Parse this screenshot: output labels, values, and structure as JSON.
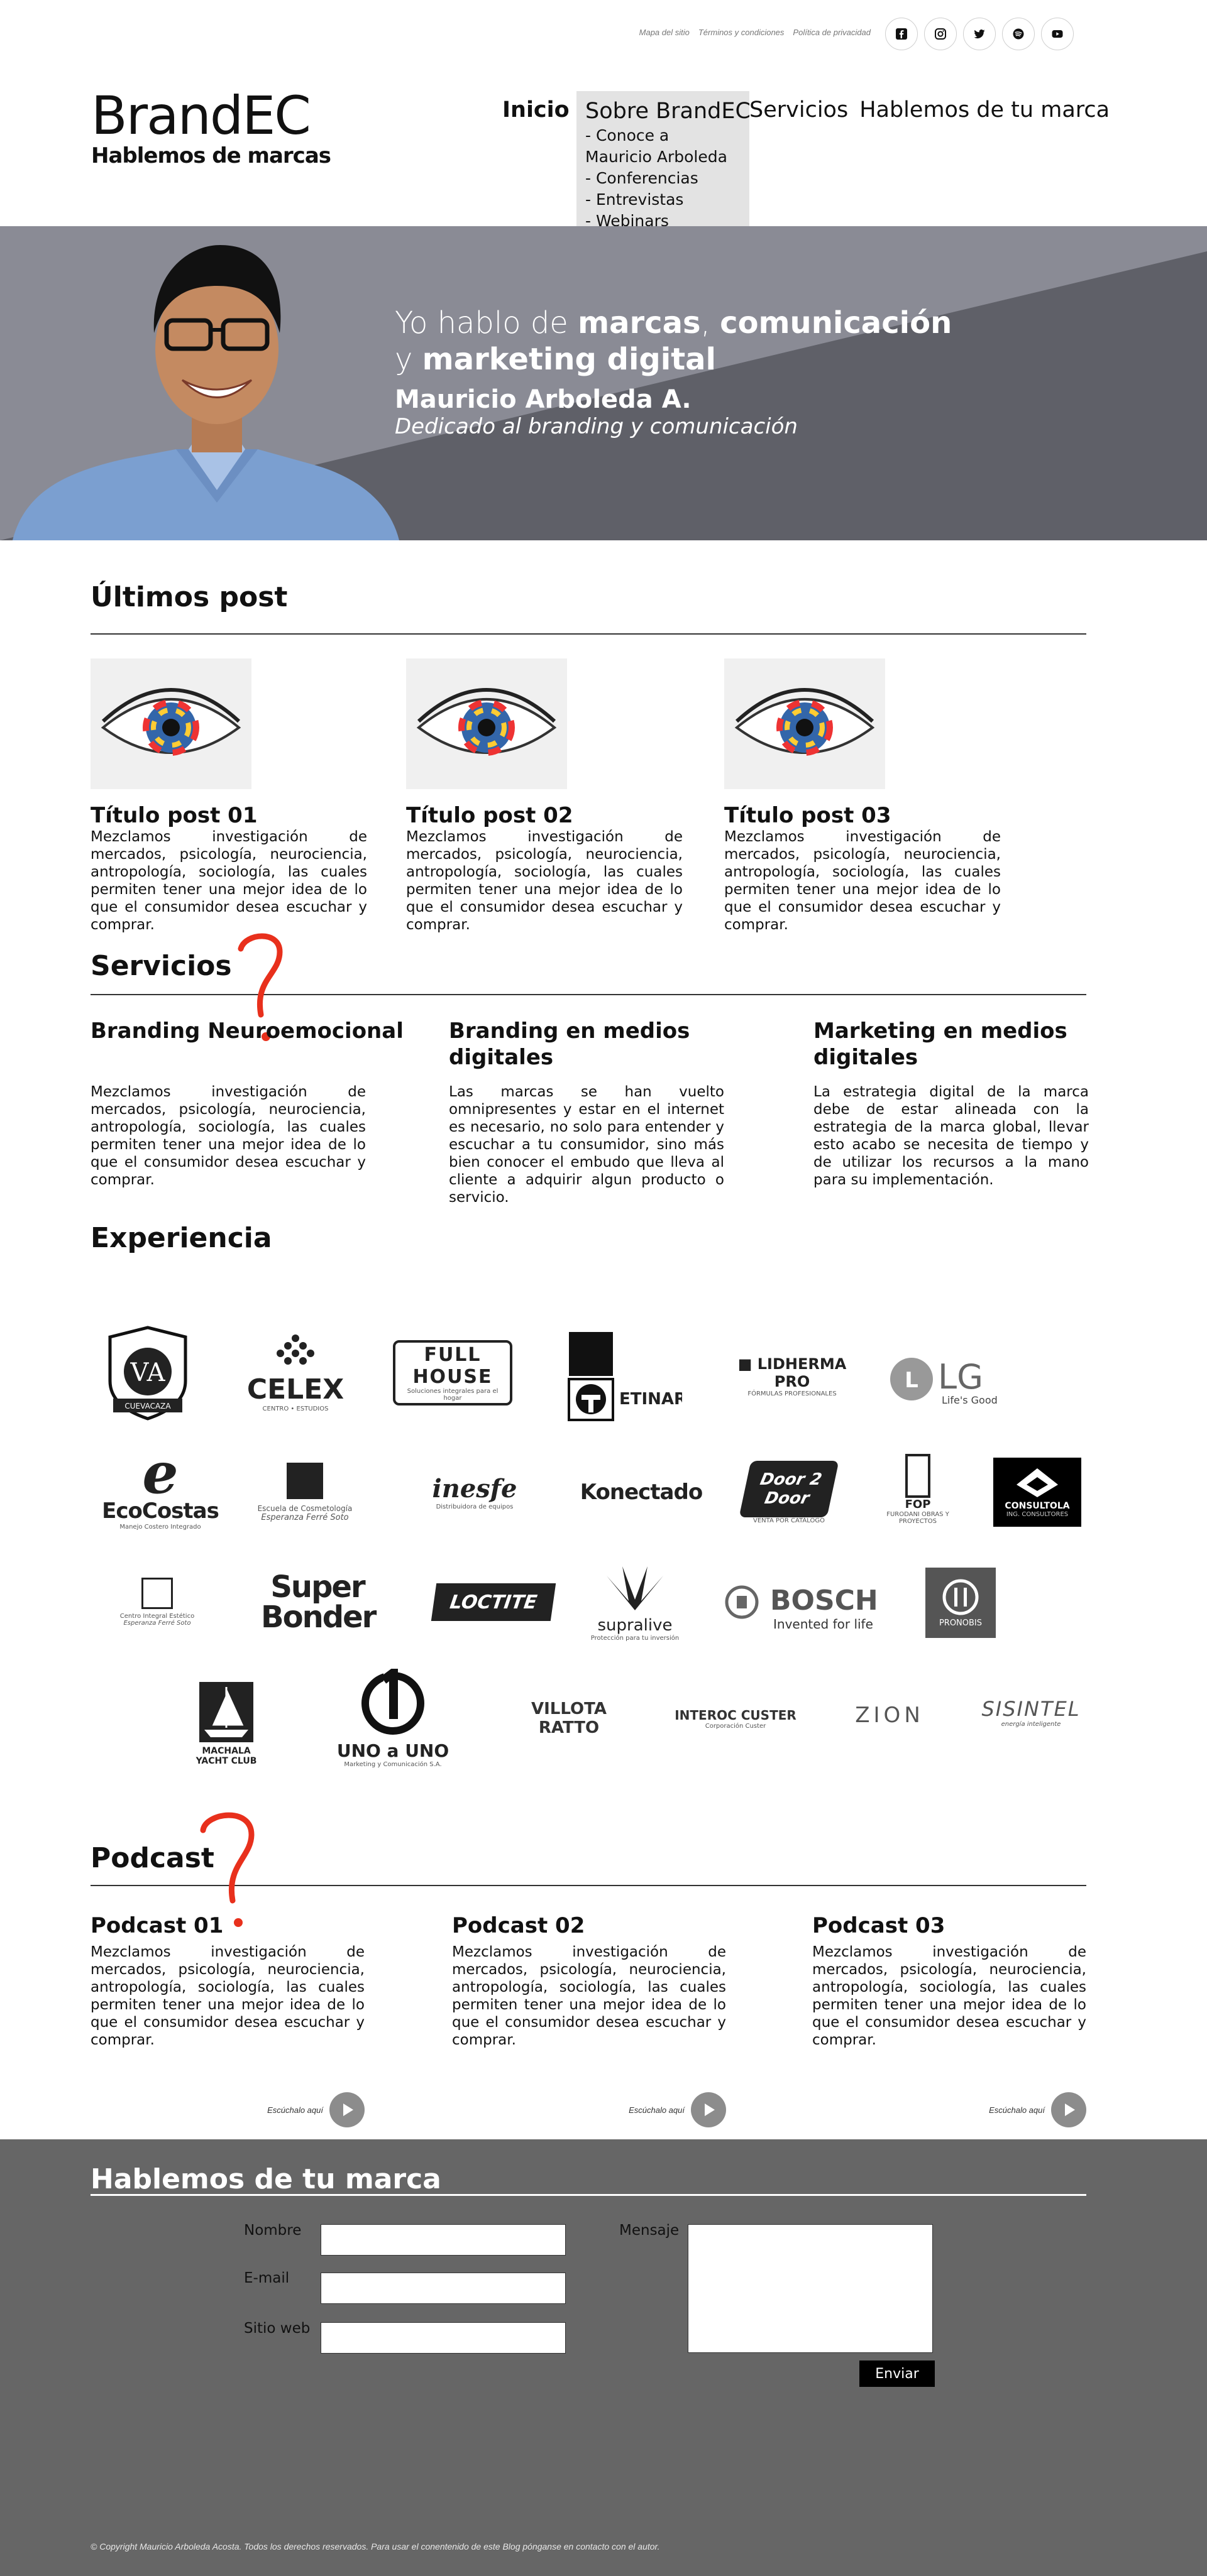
{
  "util_links": [
    "Mapa del sitio",
    "Términos y condiciones",
    "Política de privacidad"
  ],
  "social_icons": [
    "facebook-icon",
    "instagram-icon",
    "twitter-icon",
    "spotify-icon",
    "youtube-icon"
  ],
  "logo": {
    "main": "BrandEC",
    "sub": "Hablemos de marcas"
  },
  "nav": {
    "home": "Inicio",
    "about": "Sobre BrandEC",
    "about_items": [
      "- Conoce a Mauricio Arboleda",
      "- Conferencias",
      "- Entrevistas",
      "- Webinars"
    ],
    "services": "Servicios",
    "talk": "Hablemos de tu marca"
  },
  "hero": {
    "line1_a": "Yo hablo de ",
    "line1_b": "marcas",
    "line1_c": ", ",
    "line1_d": "comunicación",
    "line2_a": "y ",
    "line2_b": "marketing digital",
    "name": "Mauricio Arboleda A.",
    "role": "Dedicado al branding y comunicación"
  },
  "posts": {
    "title": "Últimos post",
    "items": [
      {
        "title": "Título post 01",
        "text": "Mezclamos investigación de mercados, psicología, neurociencia, antropología, sociología, las cuales permiten tener una mejor idea de lo que el consumidor desea escuchar y comprar."
      },
      {
        "title": "Título post 02",
        "text": "Mezclamos investigación de mercados, psicología, neurociencia, antropología, sociología, las cuales permiten tener una mejor idea de lo que el consumidor desea escuchar y comprar."
      },
      {
        "title": "Título post 03",
        "text": "Mezclamos investigación de mercados, psicología, neurociencia, antropología, sociología, las cuales permiten tener una mejor idea de lo que el consumidor desea escuchar y comprar."
      }
    ]
  },
  "services": {
    "title": "Servicios",
    "items": [
      {
        "title": "Branding Neuroemocional",
        "text": "Mezclamos investigación de mercados, psicología, neurociencia, antropología, sociología, las cuales permiten tener una mejor idea de lo que el consumidor desea escuchar y comprar."
      },
      {
        "title": "Branding en medios digitales",
        "text": "Las marcas se han vuelto omnipresentes y estar en el internet es necesario, no solo para entender y escuchar a tu consumidor, sino más bien conocer el embudo que lleva al cliente a adquirir algun producto o servicio."
      },
      {
        "title": "Marketing en medios digitales",
        "text": "La estrategia digital de la marca debe de estar alineada con la estrategia de la marca global, llevar esto acabo se necesita de tiempo y de utilizar los recursos a la mano para su implementación."
      }
    ]
  },
  "experience": {
    "title": "Experiencia",
    "logos": [
      {
        "name": "VA",
        "sub": "CUEVACAZA"
      },
      {
        "name": "CELEX",
        "sub": "CENTRO • ESTUDIOS"
      },
      {
        "name": "FULL HOUSE",
        "sub": "Soluciones integrales para el hogar"
      },
      {
        "name": "ETINAR",
        "sub": ""
      },
      {
        "name": "LIDHERMA PRO",
        "sub": "FÓRMULAS PROFESIONALES"
      },
      {
        "name": "LG",
        "sub": "Life's Good"
      },
      {
        "name": "EcoCostas",
        "sub": "Manejo Costero Integrado"
      },
      {
        "name": "Escuela de Cosmetología",
        "sub": "Esperanza Ferré Soto"
      },
      {
        "name": "inesfe",
        "sub": "Distribuidora de equipos"
      },
      {
        "name": "Konectado",
        "sub": ""
      },
      {
        "name": "Door 2 Door",
        "sub": "VENTA POR CATÁLOGO"
      },
      {
        "name": "FOP",
        "sub": "FURODANI OBRAS Y PROYECTOS"
      },
      {
        "name": "CONSULTOLA",
        "sub": "ING. CONSULTORES"
      },
      {
        "name": "Centro Integral Estético",
        "sub": "Esperanza Ferré Soto"
      },
      {
        "name": "Super Bonder",
        "sub": ""
      },
      {
        "name": "LOCTITE",
        "sub": ""
      },
      {
        "name": "supralive",
        "sub": "Protección para tu inversión"
      },
      {
        "name": "BOSCH",
        "sub": "Invented for life"
      },
      {
        "name": "PRONOBIS",
        "sub": ""
      },
      {
        "name": "MACHALA YACHT CLUB",
        "sub": ""
      },
      {
        "name": "UNO a UNO",
        "sub": "Marketing y Comunicación S.A."
      },
      {
        "name": "VILLOTA RATTO",
        "sub": ""
      },
      {
        "name": "INTEROC CUSTER",
        "sub": "Corporación Custer"
      },
      {
        "name": "ZION",
        "sub": ""
      },
      {
        "name": "SISINTEL",
        "sub": "energía inteligente"
      }
    ]
  },
  "podcast": {
    "title": "Podcast",
    "listen_label": "Escúchalo aquí",
    "items": [
      {
        "title": "Podcast 01",
        "text": "Mezclamos investigación de mercados, psicología, neurociencia, antropología, sociología, las cuales permiten tener una mejor idea de lo que el consumidor desea escuchar y comprar."
      },
      {
        "title": "Podcast 02",
        "text": "Mezclamos investigación de mercados, psicología, neurociencia, antropología, sociología, las cuales permiten tener una mejor idea de lo que el consumidor desea escuchar y comprar."
      },
      {
        "title": "Podcast 03",
        "text": "Mezclamos investigación de mercados, psicología, neurociencia, antropología, sociología, las cuales permiten tener una mejor idea de lo que el consumidor desea escuchar y comprar."
      }
    ]
  },
  "contact": {
    "title": "Hablemos de tu marca",
    "name_label": "Nombre",
    "email_label": "E-mail",
    "web_label": "Sitio web",
    "message_label": "Mensaje",
    "send_label": "Enviar",
    "name_value": "",
    "email_value": "",
    "web_value": "",
    "message_value": ""
  },
  "footer": {
    "copyright": "© Copyright Mauricio Arboleda Acosta. Todos los derechos reservados. Para usar el conentenido de este Blog pónganse en contacto con el autor."
  },
  "colors": {
    "hero_bg": "#5f6068",
    "contact_bg": "#666666",
    "annotation_red": "#e8301c",
    "send_bg": "#000000"
  }
}
